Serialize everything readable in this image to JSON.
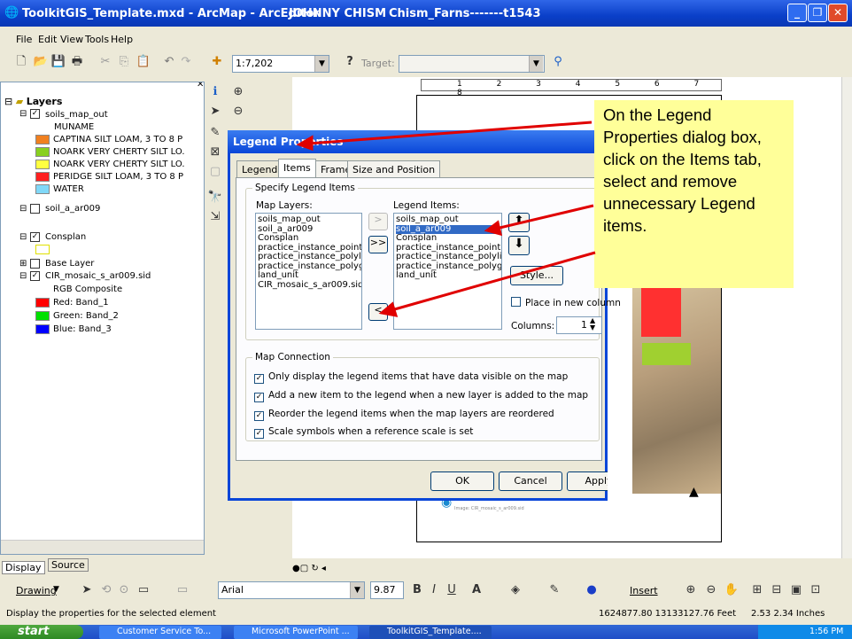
{
  "window": {
    "title": "ToolkitGIS_Template.mxd - ArcMap - ArcEditor",
    "user": "JOHNNY CHISM",
    "project": "Chism_Farns-------t1543"
  },
  "menu": [
    "File",
    "Edit",
    "View",
    "Tools",
    "Help"
  ],
  "toolbar": {
    "scale": "1:7,202",
    "target_label": "Target:",
    "ruler": "1  2  3  4  5  6  7  8"
  },
  "toc": {
    "root": "Layers",
    "layers": [
      {
        "name": "soils_map_out",
        "field": "MUNAME",
        "items": [
          {
            "label": "CAPTINA SILT LOAM, 3 TO 8 P",
            "color": "#f08020"
          },
          {
            "label": "NOARK VERY CHERTY SILT LO.",
            "color": "#88d020"
          },
          {
            "label": "NOARK VERY CHERTY SILT LO.",
            "color": "#ffff40"
          },
          {
            "label": "PERIDGE SILT LOAM, 3 TO 8 P",
            "color": "#ff2020"
          },
          {
            "label": "WATER",
            "color": "#80d8f8"
          }
        ]
      },
      {
        "name": "soil_a_ar009"
      },
      {
        "name": "Consplan"
      },
      {
        "name": "Base Layer"
      },
      {
        "name": "CIR_mosaic_s_ar009.sid",
        "field": "RGB Composite",
        "items": [
          {
            "label": "Red:  Band_1",
            "color": "#ff0000"
          },
          {
            "label": "Green: Band_2",
            "color": "#00e000"
          },
          {
            "label": "Blue:  Band_3",
            "color": "#0000ff"
          }
        ]
      }
    ],
    "tabs": [
      "Display",
      "Source"
    ]
  },
  "dialog": {
    "title": "Legend Properties",
    "tabs": [
      "Legend",
      "Items",
      "Frame",
      "Size and Position"
    ],
    "group": "Specify Legend Items",
    "map_layers_label": "Map Layers:",
    "legend_items_label": "Legend Items:",
    "map_layers": [
      "soils_map_out",
      "soil_a_ar009",
      "Consplan",
      "practice_instance_point",
      "practice_instance_polyline",
      "practice_instance_polygor",
      "land_unit",
      "CIR_mosaic_s_ar009.sid"
    ],
    "legend_items": [
      "soils_map_out",
      "soil_a_ar009",
      "Consplan",
      "practice_instance_point",
      "practice_instance_polyline",
      "practice_instance_polygor",
      "land_unit"
    ],
    "add_one": ">",
    "add_all": ">>",
    "remove": "<",
    "style": "Style...",
    "place_new_column": "Place in new column",
    "columns_label": "Columns:",
    "columns_value": "1",
    "connection_group": "Map Connection",
    "options": [
      "Only display the legend items that have data visible on the map",
      "Add a new item to the legend when a new layer is added to the map",
      "Reorder the legend items when the map layers are reordered",
      "Scale symbols when a reference scale is set"
    ],
    "ok": "OK",
    "cancel": "Cancel",
    "apply": "Apply"
  },
  "callout": "On the Legend Properties dialog box, click on the Items tab, select and remove unnecessary Legend items.",
  "drawing_toolbar": {
    "drawing": "Drawing",
    "font": "Arial",
    "size": "9.87",
    "insert": "Insert"
  },
  "map_caption": "Image: CIR_mosaic_s_ar009.sid",
  "status": {
    "message": "Display the properties for the selected element",
    "coords": "1624877.80  13133127.76 Feet",
    "size": "2.53  2.34 Inches"
  },
  "taskbar": {
    "start": "start",
    "tasks": [
      "Customer Service To...",
      "Microsoft PowerPoint ...",
      "ToolkitGIS_Template...."
    ],
    "clock": "1:56 PM"
  }
}
